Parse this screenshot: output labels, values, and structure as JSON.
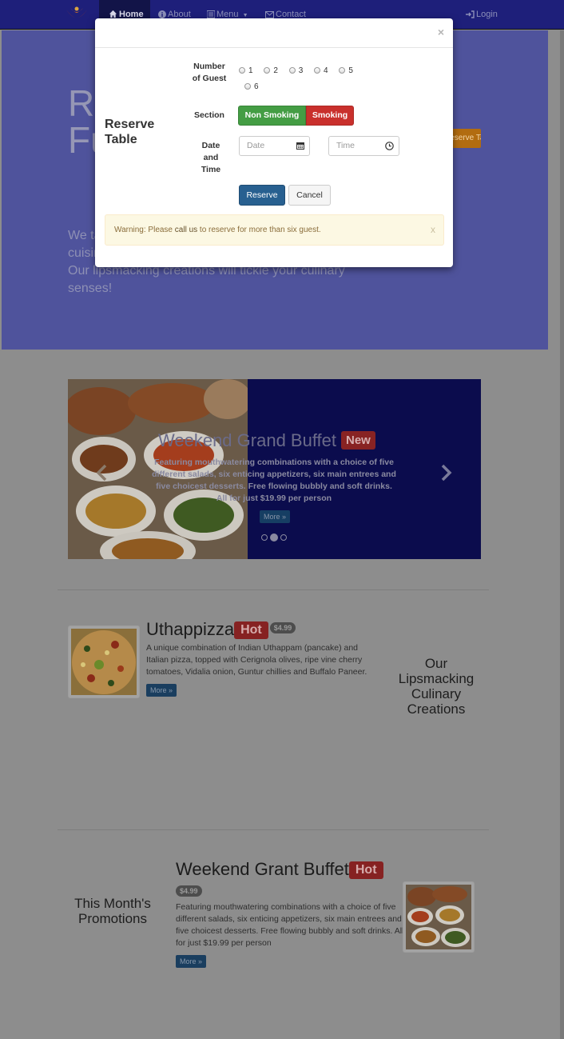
{
  "navbar": {
    "home": "Home",
    "about": "About",
    "menu": "Menu",
    "contact": "Contact",
    "login": "Login"
  },
  "jumbotron": {
    "title_line1": "R",
    "title_line2": "Fu",
    "text_line1": "We ta",
    "text_line2": "cuisin",
    "text_line3": "Our lipsmacking creations will tickle your culinary",
    "text_line4": "senses!",
    "reserve_button": "Reserve Table"
  },
  "carousel": {
    "title": "Weekend Grand Buffet",
    "badge": "New",
    "text": "Featuring mouthwatering combinations with a choice of five different salads, six enticing appetizers, six main entrees and five choicest desserts. Free flowing bubbly and soft drinks. All for just $19.99 per person",
    "more": "More »"
  },
  "dish": {
    "name": "Uthappizza",
    "badge": "Hot",
    "price": "$4.99",
    "description": "A unique combination of Indian Uthappam (pancake) and Italian pizza, topped with Cerignola olives, ripe vine cherry tomatoes, Vidalia onion, Guntur chillies and Buffalo Paneer.",
    "more": "More »",
    "side_heading": "Our Lipsmacking Culinary Creations"
  },
  "promotion": {
    "side_heading": "This Month's Promotions",
    "name": "Weekend Grant Buffet",
    "badge": "Hot",
    "price": "$4.99",
    "description": "Featuring mouthwatering combinations with a choice of five different salads, six enticing appetizers, six main entrees and five choicest desserts. Free flowing bubbly and soft drinks. All for just $19.99 per person",
    "more": "More »"
  },
  "modal": {
    "close": "×",
    "title": "Reserve Table",
    "guests_label": "Number of Guest",
    "guest_options": [
      "1",
      "2",
      "3",
      "4",
      "5",
      "6"
    ],
    "section_label": "Section",
    "section_options": [
      "Non Smoking",
      "Smoking"
    ],
    "datetime_label": "Date and Time",
    "date_placeholder": "Date",
    "time_placeholder": "Time",
    "reserve_button": "Reserve",
    "cancel_button": "Cancel",
    "alert_prefix": "Warning: Please ",
    "alert_bold": "call us",
    "alert_suffix": " to reserve for more than six guest.",
    "alert_close": "x"
  },
  "colors": {
    "navbar": "#1e1f7a",
    "jumbotron": "#4f539c",
    "overlay": "#8d8d8d",
    "success": "#449d44",
    "danger": "#c9302c",
    "primary": "#286090",
    "warning_bg": "#fcf8e3"
  }
}
